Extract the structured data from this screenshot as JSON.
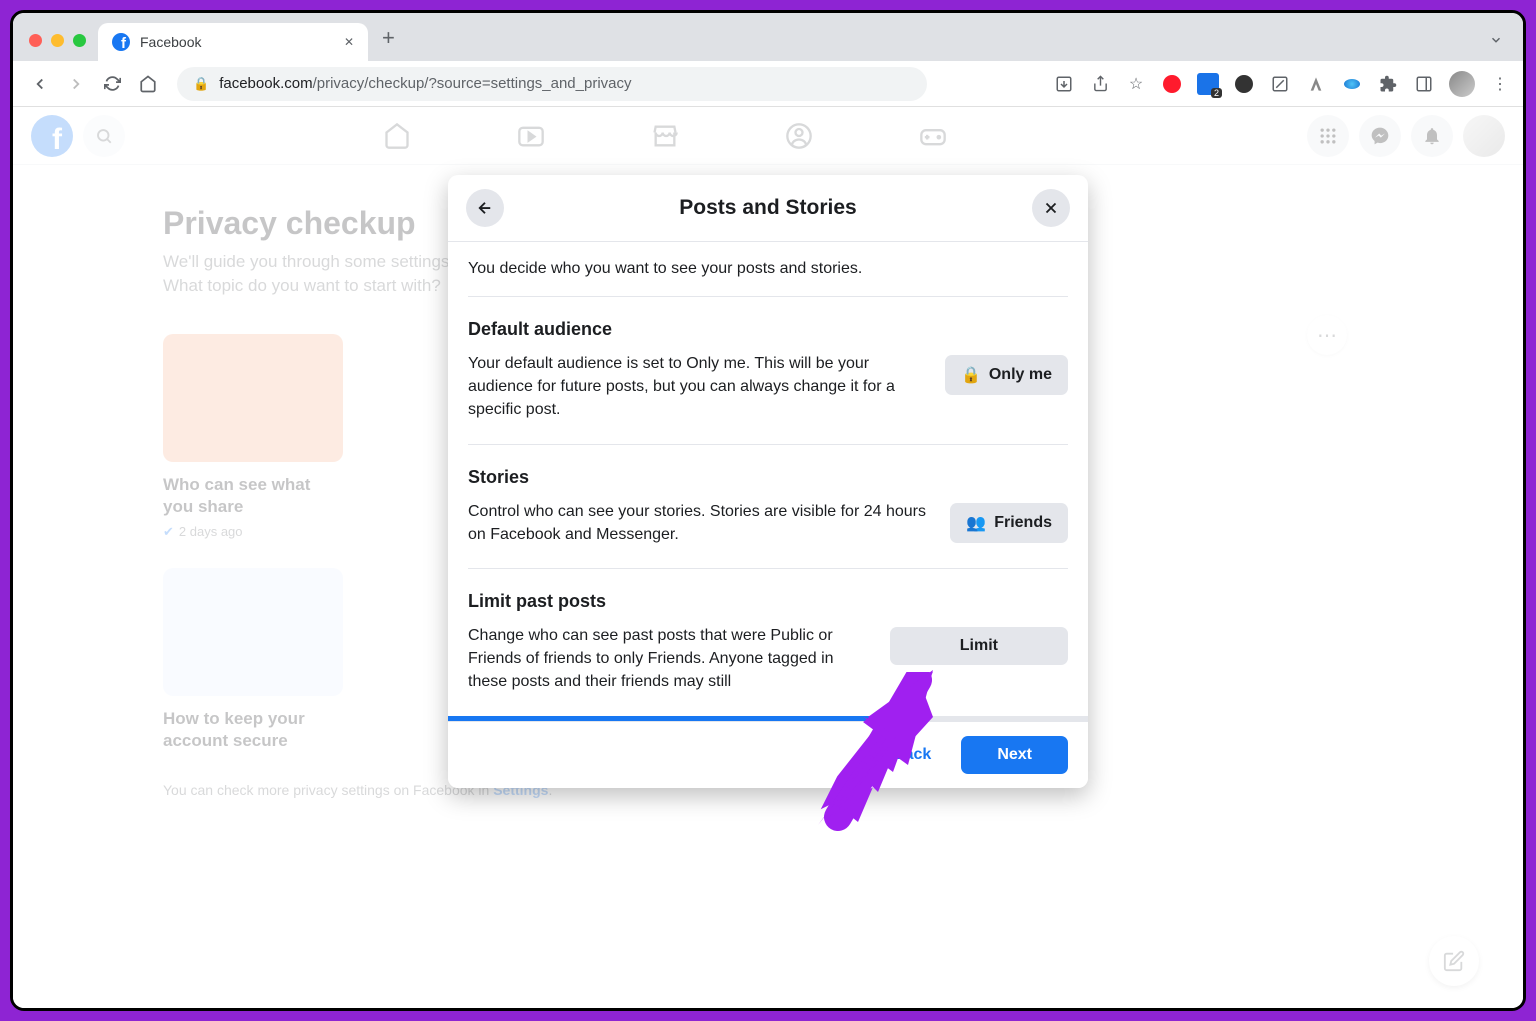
{
  "browser": {
    "tab_title": "Facebook",
    "url_domain": "facebook.com",
    "url_path": "/privacy/checkup/?source=settings_and_privacy",
    "ext_badge": "2"
  },
  "page": {
    "title": "Privacy checkup",
    "subtitle_line1": "We'll guide you through some settings so you can make the right choices for your account.",
    "subtitle_line2": "What topic do you want to start with?",
    "card1_title": "Who can see what you share",
    "card1_meta": "2 days ago",
    "card2_title": "How to keep your account secure",
    "footer_text": "You can check more privacy settings on Facebook in ",
    "footer_link": "Settings"
  },
  "modal": {
    "title": "Posts and Stories",
    "intro": "You decide who you want to see your posts and stories.",
    "s1_title": "Default audience",
    "s1_desc": "Your default audience is set to Only me. This will be your audience for future posts, but you can always change it for a specific post.",
    "s1_btn": "Only me",
    "s2_title": "Stories",
    "s2_desc": "Control who can see your stories. Stories are visible for 24 hours on Facebook and Messenger.",
    "s2_btn": "Friends",
    "s3_title": "Limit past posts",
    "s3_desc": "Change who can see past posts that were Public or Friends of friends to only Friends. Anyone tagged in these posts and their friends may still",
    "s3_btn": "Limit",
    "back": "Back",
    "next": "Next"
  }
}
